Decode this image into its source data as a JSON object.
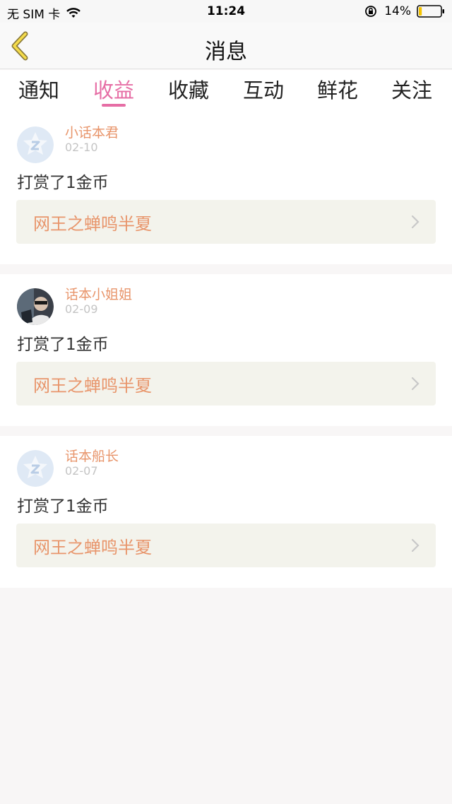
{
  "status_bar": {
    "carrier": "无 SIM 卡",
    "time": "11:24",
    "battery": "14%",
    "battery_level": 0.14
  },
  "header": {
    "title": "消息"
  },
  "tabs": [
    {
      "label": "通知",
      "active": false
    },
    {
      "label": "收益",
      "active": true
    },
    {
      "label": "收藏",
      "active": false
    },
    {
      "label": "互动",
      "active": false
    },
    {
      "label": "鲜花",
      "active": false
    },
    {
      "label": "关注",
      "active": false
    }
  ],
  "messages": [
    {
      "author": "小话本君",
      "date": "02-10",
      "text": "打赏了1金币",
      "book": "网王之蝉鸣半夏",
      "avatar": "default-avatar-icon"
    },
    {
      "author": "话本小姐姐",
      "date": "02-09",
      "text": "打赏了1金币",
      "book": "网王之蝉鸣半夏",
      "avatar": "user-photo-avatar"
    },
    {
      "author": "话本船长",
      "date": "02-07",
      "text": "打赏了1金币",
      "book": "网王之蝉鸣半夏",
      "avatar": "default-avatar-icon"
    }
  ],
  "colors": {
    "accent": "#e66ea5",
    "author": "#e8956b",
    "book_bg": "#f3f3ec"
  }
}
